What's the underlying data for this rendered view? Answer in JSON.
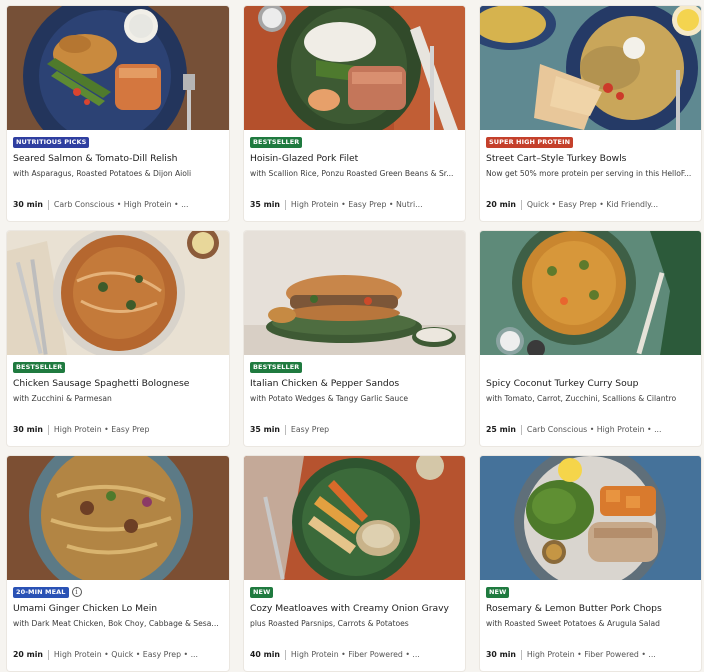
{
  "colors": {
    "badge_nutritious": "#2f3fa0",
    "badge_bestseller": "#1f7a3f",
    "badge_super_protein": "#c4402b",
    "badge_20min": "#2a52b5",
    "badge_new": "#1f7a3f"
  },
  "recipes": [
    {
      "badge": "NUTRITIOUS PICKS",
      "title": "Seared Salmon & Tomato-Dill Relish",
      "subtitle": "with Asparagus, Roasted Potatoes & Dijon Aioli",
      "time": "30 min",
      "tags": "Carb Conscious • High Protein • ..."
    },
    {
      "badge": "BESTSELLER",
      "title": "Hoisin-Glazed Pork Filet",
      "subtitle": "with Scallion Rice, Ponzu Roasted Green Beans & Sr...",
      "time": "35 min",
      "tags": "High Protein • Easy Prep • Nutri..."
    },
    {
      "badge": "SUPER HIGH PROTEIN",
      "title": "Street Cart–Style Turkey Bowls",
      "subtitle": "Now get 50% more protein per serving in this HelloF...",
      "time": "20 min",
      "tags": "Quick • Easy Prep • Kid Friendly..."
    },
    {
      "badge": "BESTSELLER",
      "title": "Chicken Sausage Spaghetti Bolognese",
      "subtitle": "with Zucchini & Parmesan",
      "time": "30 min",
      "tags": "High Protein • Easy Prep"
    },
    {
      "badge": "BESTSELLER",
      "title": "Italian Chicken & Pepper Sandos",
      "subtitle": "with Potato Wedges & Tangy Garlic Sauce",
      "time": "35 min",
      "tags": "Easy Prep"
    },
    {
      "badge": "",
      "title": "Spicy Coconut Turkey Curry Soup",
      "subtitle": "with Tomato, Carrot, Zucchini, Scallions & Cilantro",
      "time": "25 min",
      "tags": "Carb Conscious • High Protein • ..."
    },
    {
      "badge": "20-MIN MEAL",
      "title": "Umami Ginger Chicken Lo Mein",
      "subtitle": "with Dark Meat Chicken, Bok Choy, Cabbage & Sesa...",
      "time": "20 min",
      "tags": "High Protein • Quick • Easy Prep • ..."
    },
    {
      "badge": "NEW",
      "title": "Cozy Meatloaves with Creamy Onion Gravy",
      "subtitle": "plus Roasted Parsnips, Carrots & Potatoes",
      "time": "40 min",
      "tags": "High Protein • Fiber Powered • ..."
    },
    {
      "badge": "NEW",
      "title": "Rosemary & Lemon Butter Pork Chops",
      "subtitle": "with Roasted Sweet Potatoes & Arugula Salad",
      "time": "30 min",
      "tags": "High Protein • Fiber Powered • ..."
    }
  ]
}
